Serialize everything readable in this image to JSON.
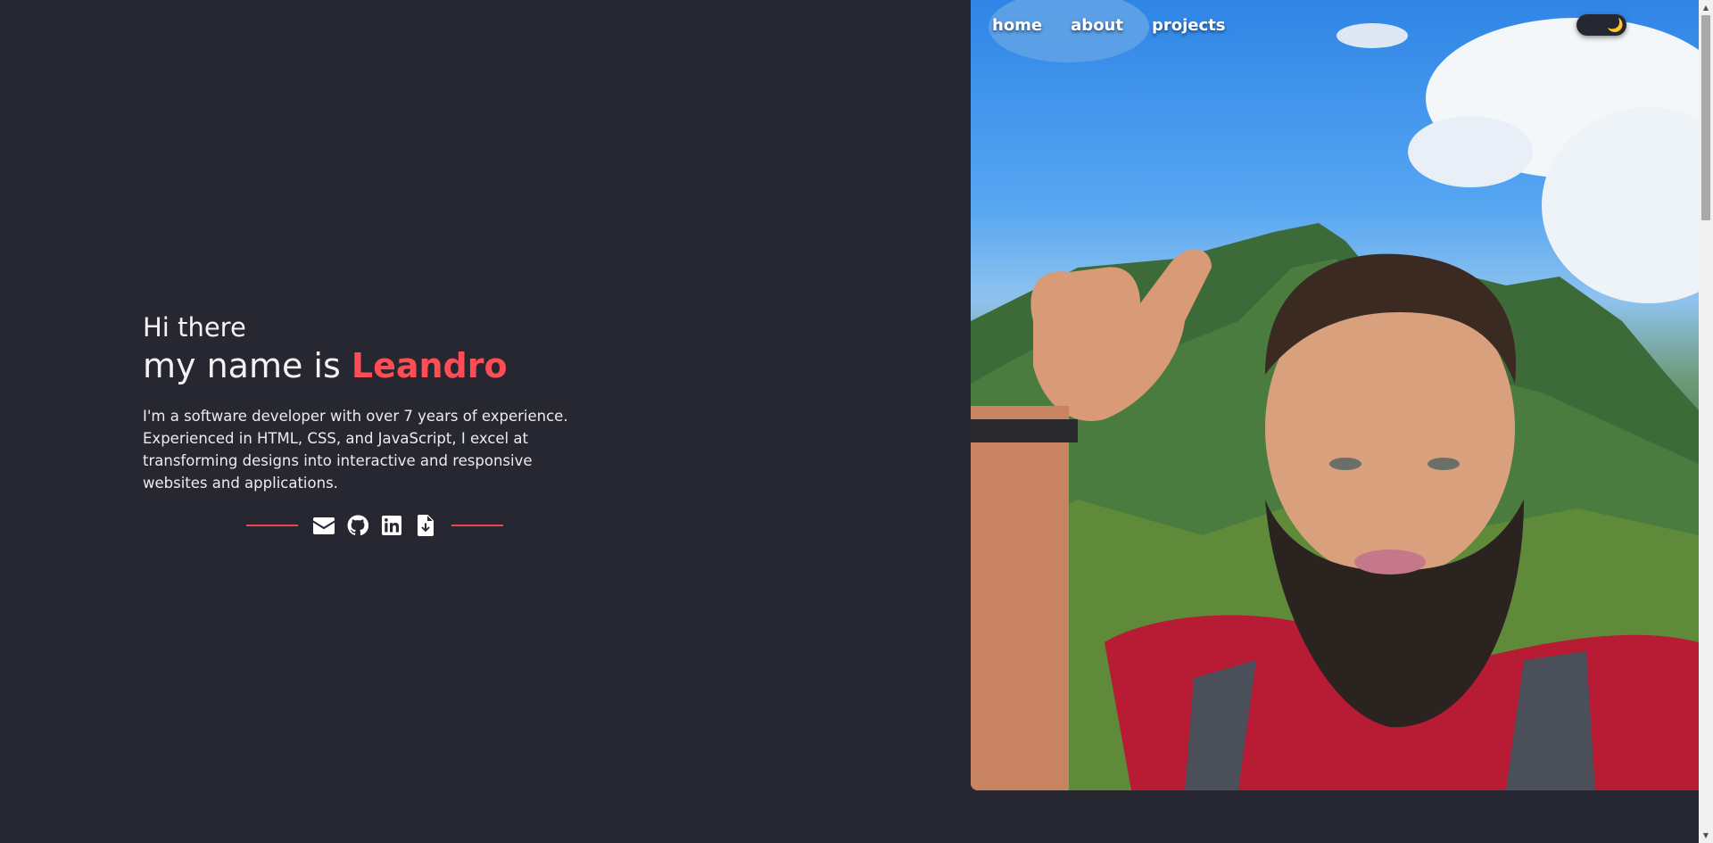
{
  "nav": {
    "links": [
      "home",
      "about",
      "projects"
    ]
  },
  "theme_toggle": {
    "icon": "moon-icon",
    "symbol": "🌙"
  },
  "intro": {
    "greeting": "Hi there",
    "name_prefix": "my name is ",
    "name": "Leandro",
    "bio": "I'm a software developer with over 7 years of experience. Experienced in HTML, CSS, and JavaScript, I excel at transforming designs into interactive and responsive websites and applications."
  },
  "social": {
    "icons": [
      "envelope-icon",
      "github-icon",
      "linkedin-icon",
      "file-download-icon"
    ]
  },
  "colors": {
    "background": "#262731",
    "accent": "#ff4d55",
    "text": "#f2f2f2"
  },
  "scrollbar": {
    "up_arrow": "▲",
    "down_arrow": "▼"
  }
}
